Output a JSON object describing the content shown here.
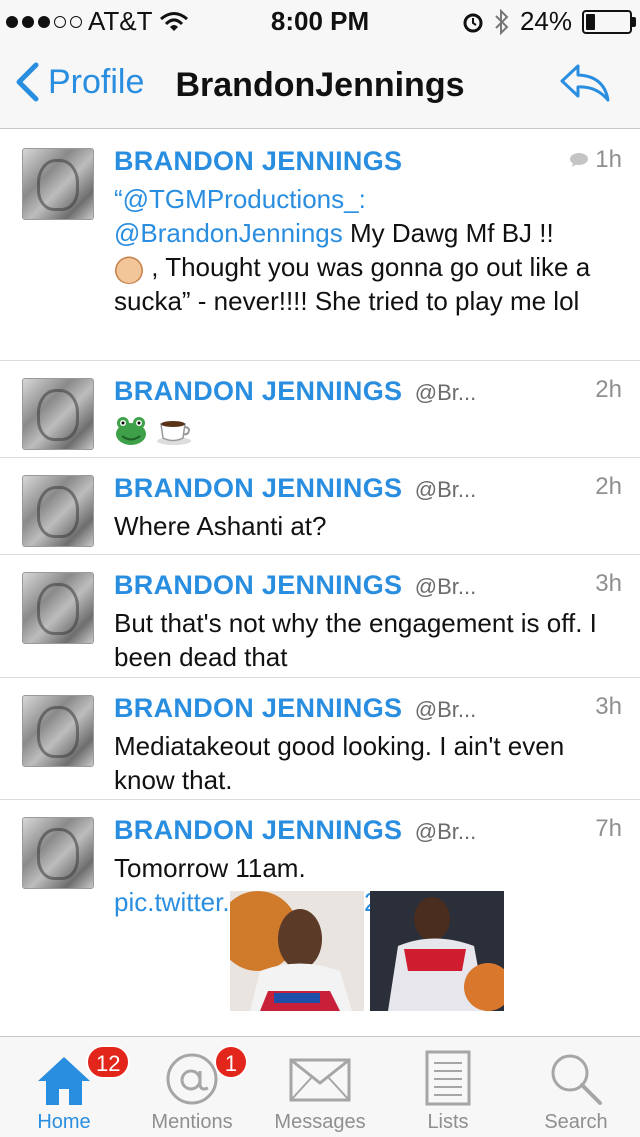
{
  "status_bar": {
    "carrier": "AT&T",
    "time": "8:00 PM",
    "battery": "24%",
    "battery_level": 0.24,
    "signal_bars_filled": 3,
    "signal_bars_total": 5
  },
  "nav": {
    "back_label": "Profile",
    "title": "BrandonJennings"
  },
  "tweets": [
    {
      "name": "BRANDON JENNINGS",
      "handle": "",
      "time": "1h",
      "mention1": "“@TGMProductions_:",
      "mention2": "@BrandonJennings",
      "text_a": "My Dawg Mf BJ !!",
      "text_b": ", Thought you was gonna go out like a sucka” - never!!!! She tried to play me lol"
    },
    {
      "name": "BRANDON JENNINGS",
      "handle": "@Br...",
      "time": "2h",
      "text": ""
    },
    {
      "name": "BRANDON JENNINGS",
      "handle": "@Br...",
      "time": "2h",
      "text": "Where Ashanti at?"
    },
    {
      "name": "BRANDON JENNINGS",
      "handle": "@Br...",
      "time": "3h",
      "text": "But that's not why the engagement is off. I been dead that"
    },
    {
      "name": "BRANDON JENNINGS",
      "handle": "@Br...",
      "time": "3h",
      "text": "Mediatakeout good looking. I ain't even know that."
    },
    {
      "name": "BRANDON JENNINGS",
      "handle": "@Br...",
      "time": "7h",
      "text": "Tomorrow 11am.",
      "link": "pic.twitter.com/uSrVQ2s54a"
    }
  ],
  "tabs": [
    {
      "label": "Home",
      "badge": "12"
    },
    {
      "label": "Mentions",
      "badge": "1"
    },
    {
      "label": "Messages"
    },
    {
      "label": "Lists"
    },
    {
      "label": "Search"
    }
  ],
  "colors": {
    "accent": "#2a8ee0",
    "badge": "#e3261b",
    "muted": "#8f8f8f"
  },
  "icons": [
    "wifi-icon",
    "alarm-icon",
    "bluetooth-icon",
    "battery-icon",
    "back-chevron-icon",
    "reply-icon",
    "comment-bubble-icon",
    "raised-fist-emoji",
    "frog-emoji",
    "coffee-emoji",
    "home-icon",
    "mentions-at-icon",
    "messages-envelope-icon",
    "lists-icon",
    "search-icon"
  ]
}
